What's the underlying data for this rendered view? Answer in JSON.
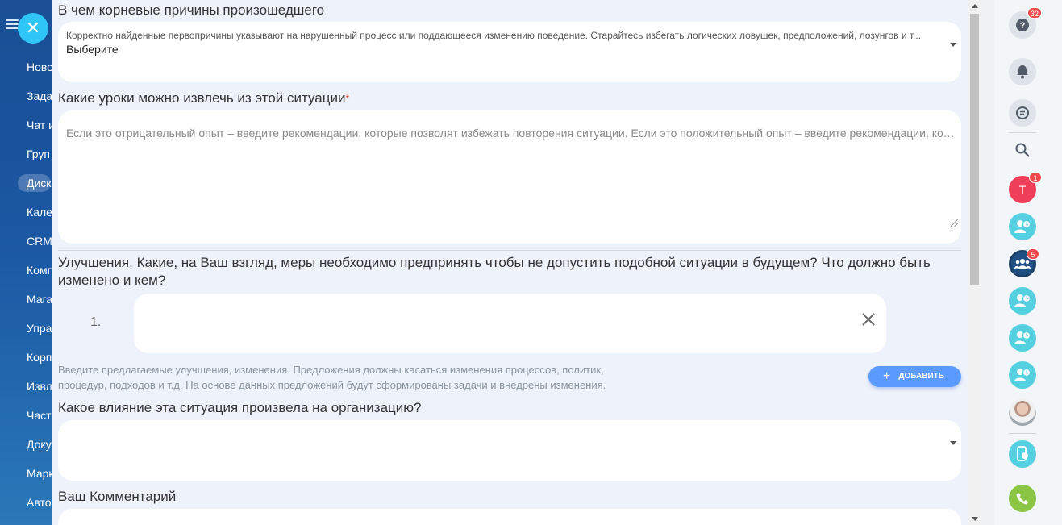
{
  "left_nav": {
    "items": [
      {
        "label": "Ново",
        "active": false
      },
      {
        "label": "Зада",
        "active": false
      },
      {
        "label": "Чат и",
        "active": false
      },
      {
        "label": "Груп",
        "active": false
      },
      {
        "label": "Диск",
        "active": true
      },
      {
        "label": "Кале",
        "active": false
      },
      {
        "label": "CRM",
        "active": false
      },
      {
        "label": "Комп",
        "active": false
      },
      {
        "label": "Мага",
        "active": false
      },
      {
        "label": "Упра",
        "active": false
      },
      {
        "label": "Корп",
        "active": false
      },
      {
        "label": "Извл",
        "active": false
      },
      {
        "label": "Част",
        "active": false
      },
      {
        "label": "Доку",
        "active": false
      },
      {
        "label": "Марк",
        "active": false
      },
      {
        "label": "Авто",
        "active": false
      }
    ]
  },
  "form": {
    "root_causes": {
      "label": "В чем корневые причины произошедшего",
      "hint": "Корректно найденные первопричины указывают на нарушенный процесс или поддающееся изменению поведение. Старайтесь избегать логических ловушек, предположений, лозунгов и т...",
      "value": "Выберите"
    },
    "lessons": {
      "label": "Какие уроки можно извлечь из этой ситуации",
      "required_mark": "*",
      "placeholder": "Если это отрицательный опыт – введите рекомендации, которые позволят избежать повторения ситуации. Если это положительный опыт – введите рекомендации, которы..."
    },
    "improvements": {
      "label": "Улучшения. Какие, на Ваш взгляд, меры необходимо предпринять чтобы не допустить подобной ситуации в будущем? Что должно быть изменено и кем?",
      "item_number": "1.",
      "item_value": "",
      "help": "Введите предлагаемые улучшения, изменения. Предложения должны касаться изменения процессов, политик, процедур, подходов и т.д. На основе данных предложений будут сформированы задачи и внедрены изменения.",
      "add_label": "ДОБАВИТЬ"
    },
    "impact": {
      "label": "Какое влияние эта ситуация произвела на организацию?",
      "value": ""
    },
    "comment": {
      "label": "Ваш Комментарий"
    }
  },
  "right_panel": {
    "help_badge": "32",
    "user_initial": "Т",
    "user_badge": "1",
    "group_badge": "5"
  },
  "colors": {
    "sidebar": "#1b57a3",
    "accent": "#2fc6f6",
    "add_button": "#5b9bff",
    "call_button": "#8ac644",
    "required": "#f0371b"
  }
}
